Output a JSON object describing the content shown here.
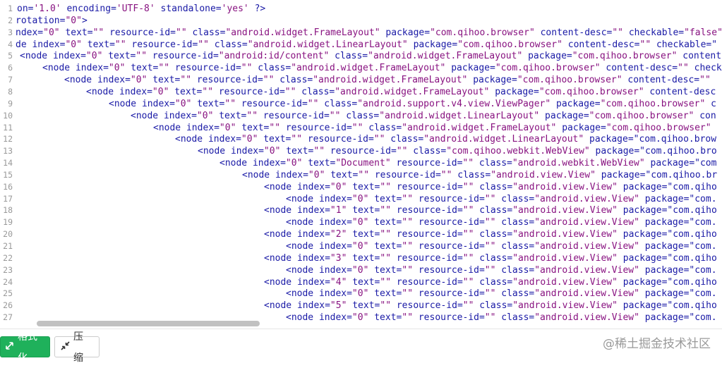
{
  "editor": {
    "lines": [
      {
        "n": "1",
        "indent": 0,
        "text": "on='1.0' encoding='UTF-8' standalone='yes' ?>",
        "clip": 24
      },
      {
        "n": "2",
        "indent": 0,
        "text": "rotation=\"0\">",
        "clip": 22
      },
      {
        "n": "3",
        "indent": 0,
        "text": "ndex=\"0\" text=\"\" resource-id=\"\" class=\"android.widget.FrameLayout\" package=\"com.qihoo.browser\" content-desc=\"\" checkable=\"false\"",
        "clip": 22
      },
      {
        "n": "4",
        "indent": 0,
        "text": "de index=\"0\" text=\"\" resource-id=\"\" class=\"android.widget.LinearLayout\" package=\"com.qihoo.browser\" content-desc=\"\" checkable=\"",
        "clip": 22
      },
      {
        "n": "5",
        "indent": 0,
        "text": "<node index=\"0\" text=\"\" resource-id=\"android:id/content\" class=\"android.widget.FrameLayout\" package=\"com.qihoo.browser\" content",
        "clip": 28
      },
      {
        "n": "6",
        "indent": 0,
        "text": "<node index=\"0\" text=\"\" resource-id=\"\" class=\"android.widget.FrameLayout\" package=\"com.qihoo.browser\" content-desc=\"\" check",
        "clip": 60
      },
      {
        "n": "7",
        "indent": 0,
        "text": "<node index=\"0\" text=\"\" resource-id=\"\" class=\"android.widget.FrameLayout\" package=\"com.qihoo.browser\" content-desc=\"\" ",
        "clip": 91
      },
      {
        "n": "8",
        "indent": 0,
        "text": "<node index=\"0\" text=\"\" resource-id=\"\" class=\"android.widget.FrameLayout\" package=\"com.qihoo.browser\" content-desc",
        "clip": 122
      },
      {
        "n": "9",
        "indent": 0,
        "text": "<node index=\"0\" text=\"\" resource-id=\"\" class=\"android.support.v4.view.ViewPager\" package=\"com.qihoo.browser\" c",
        "clip": 154
      },
      {
        "n": "10",
        "indent": 0,
        "text": "<node index=\"0\" text=\"\" resource-id=\"\" class=\"android.widget.LinearLayout\" package=\"com.qihoo.browser\" con",
        "clip": 185
      },
      {
        "n": "11",
        "indent": 0,
        "text": "<node index=\"0\" text=\"\" resource-id=\"\" class=\"android.widget.FrameLayout\" package=\"com.qihoo.browser\" ",
        "clip": 217
      },
      {
        "n": "12",
        "indent": 0,
        "text": "<node index=\"0\" text=\"\" resource-id=\"\" class=\"android.widget.LinearLayout\" package=\"com.qihoo.brow",
        "clip": 248
      },
      {
        "n": "13",
        "indent": 0,
        "text": "<node index=\"0\" text=\"\" resource-id=\"\" class=\"com.qihoo.webkit.WebView\" package=\"com.qihoo.bro",
        "clip": 280
      },
      {
        "n": "14",
        "indent": 0,
        "text": "<node index=\"0\" text=\"Document\" resource-id=\"\" class=\"android.webkit.WebView\" package=\"com",
        "clip": 311
      },
      {
        "n": "15",
        "indent": 0,
        "text": "<node index=\"0\" text=\"\" resource-id=\"\" class=\"android.view.View\" package=\"com.qihoo.br",
        "clip": 343
      },
      {
        "n": "16",
        "indent": 0,
        "text": "<node index=\"0\" text=\"\" resource-id=\"\" class=\"android.view.View\" package=\"com.qiho",
        "clip": 374
      },
      {
        "n": "17",
        "indent": 0,
        "text": "<node index=\"0\" text=\"\" resource-id=\"\" class=\"android.view.View\" package=\"com.",
        "clip": 405
      },
      {
        "n": "18",
        "indent": 0,
        "text": "<node index=\"1\" text=\"\" resource-id=\"\" class=\"android.view.View\" package=\"com.qiho",
        "clip": 374
      },
      {
        "n": "19",
        "indent": 0,
        "text": "<node index=\"0\" text=\"\" resource-id=\"\" class=\"android.view.View\" package=\"com.",
        "clip": 405
      },
      {
        "n": "20",
        "indent": 0,
        "text": "<node index=\"2\" text=\"\" resource-id=\"\" class=\"android.view.View\" package=\"com.qiho",
        "clip": 374
      },
      {
        "n": "21",
        "indent": 0,
        "text": "<node index=\"0\" text=\"\" resource-id=\"\" class=\"android.view.View\" package=\"com.",
        "clip": 405
      },
      {
        "n": "22",
        "indent": 0,
        "text": "<node index=\"3\" text=\"\" resource-id=\"\" class=\"android.view.View\" package=\"com.qiho",
        "clip": 374
      },
      {
        "n": "23",
        "indent": 0,
        "text": "<node index=\"0\" text=\"\" resource-id=\"\" class=\"android.view.View\" package=\"com.",
        "clip": 405
      },
      {
        "n": "24",
        "indent": 0,
        "text": "<node index=\"4\" text=\"\" resource-id=\"\" class=\"android.view.View\" package=\"com.qiho",
        "clip": 374
      },
      {
        "n": "25",
        "indent": 0,
        "text": "<node index=\"0\" text=\"\" resource-id=\"\" class=\"android.view.View\" package=\"com.",
        "clip": 405
      },
      {
        "n": "26",
        "indent": 0,
        "text": "<node index=\"5\" text=\"\" resource-id=\"\" class=\"android.view.View\" package=\"com.qiho",
        "clip": 374
      },
      {
        "n": "27",
        "indent": 0,
        "text": "<node index=\"0\" text=\"\" resource-id=\"\" class=\"android.view.View\" package=\"com.",
        "clip": 405
      }
    ]
  },
  "toolbar": {
    "format_label": "格式化",
    "compress_label": "压缩"
  },
  "watermark": "@稀土掘金技术社区",
  "colors": {
    "format_button": "#1fb15b",
    "tag_text": "#1a1aa6",
    "value_text": "#881280"
  },
  "icons": {
    "format": "expand-arrows-icon",
    "compress": "compress-arrows-icon"
  }
}
